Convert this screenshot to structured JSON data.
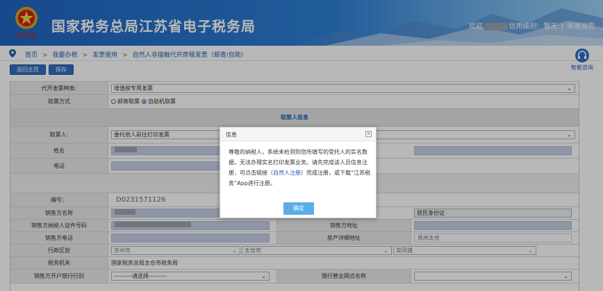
{
  "header": {
    "title": "国家税务总局江苏省电子税务局",
    "welcome": "欢迎",
    "credit_label": "信用级别：暂无",
    "close_label": "关闭当页",
    "separator": "|"
  },
  "breadcrumb": {
    "items": [
      "首页",
      "我要办税",
      "发票使用",
      "自然人非接触代开房租发票（邮寄/自助）"
    ],
    "arrow": ">"
  },
  "assistant": {
    "label": "智能咨询"
  },
  "toolbar": {
    "home_label": "返回主页",
    "save_label": "保存"
  },
  "form": {
    "invoice_type_label": "代开发票种类:",
    "invoice_type_value": "增值税专用发票",
    "pickup_method_label": "取票方式",
    "pickup_mail": "邮寄取票",
    "pickup_self": "自助机取票",
    "pickup_selected": "自助机取票",
    "section_title": "取票人信息",
    "picker_label": "取票人:",
    "picker_value": "委托他人前往打印发票",
    "name_label": "姓名",
    "phone_label": "电话",
    "number_label": "编号：",
    "number_value": "D0231571126",
    "seller_name_label": "销售方名称",
    "seller_id_type_value": "居民身份证",
    "seller_taxid_label": "销售方纳税人证件号码",
    "seller_address_label": "销售方地址",
    "seller_phone_label": "销售方电话",
    "property_address_label": "房产详细地址",
    "property_address_value": "苏州太仓",
    "district_label": "行政区划",
    "district_city": "苏州市",
    "district_county": "太仓市",
    "district_town": "双凤镇",
    "tax_office_label": "税务机关",
    "tax_office_value": "国家税务总局太仓市税务局",
    "bank_label": "销售方开户银行行别",
    "bank_value": "---------请选择---------",
    "branch_label": "银行营业网点名称"
  },
  "modal": {
    "title": "信息",
    "close_icon": "×",
    "body_before": "尊敬的纳税人，系统未检测到您所填写的受托人的实名数据，无法办理实名打印发票业务。请先完成该人员信息注册，可点击链接（",
    "body_link": "自然人注册",
    "body_after": "）完成注册，或下载“江苏税务”App进行注册。",
    "ok_label": "确定"
  }
}
